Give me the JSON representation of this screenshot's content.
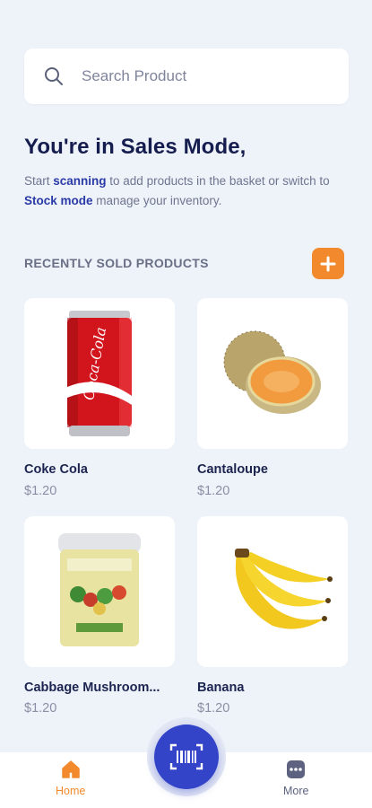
{
  "search": {
    "placeholder": "Search Product"
  },
  "heading": "You're in Sales Mode,",
  "subtitle": {
    "part1": "Start ",
    "link1": "scanning",
    "part2": " to add products in the basket or switch to ",
    "link2": "Stock mode",
    "part3": " manage your inventory."
  },
  "section": {
    "title": "RECENTLY SOLD PRODUCTS",
    "add_icon": "plus-icon"
  },
  "products": [
    {
      "name": "Coke Cola",
      "price": "$1.20",
      "image": "coke-can"
    },
    {
      "name": "Cantaloupe",
      "price": "$1.20",
      "image": "cantaloupe"
    },
    {
      "name": "Cabbage Mushroom...",
      "price": "$1.20",
      "image": "canned-food"
    },
    {
      "name": "Banana",
      "price": "$1.20",
      "image": "banana-bunch"
    }
  ],
  "nav": {
    "home": {
      "label": "Home",
      "icon": "home-icon"
    },
    "scan": {
      "icon": "barcode-scan-icon"
    },
    "more": {
      "label": "More",
      "icon": "more-icon"
    }
  },
  "colors": {
    "background": "#eef2f9",
    "primary": "#3344c8",
    "accent": "#f28a2d",
    "heading": "#151d4f"
  }
}
